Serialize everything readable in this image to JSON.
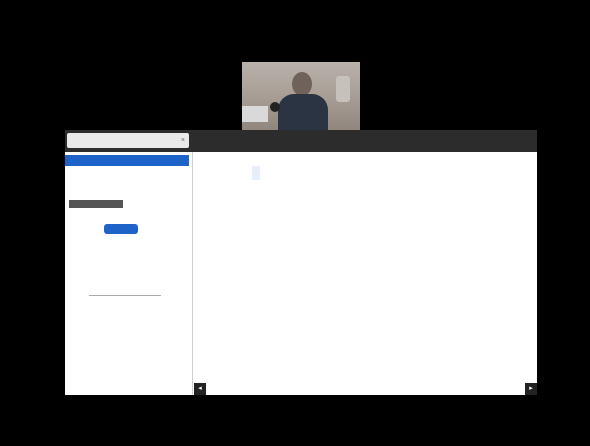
{
  "tab": {
    "title": "",
    "close_glyph": "×"
  },
  "menu": {
    "left": "",
    "right": ""
  },
  "panel": {
    "selected_row": "",
    "text_block": "",
    "note": "",
    "button_label": "",
    "note2": "",
    "small_label": "",
    "math_small": ""
  },
  "canvas": {
    "eq1_left": "",
    "eq1_highlight": "",
    "eq_number": "",
    "eq2": "",
    "mark": "",
    "nav_prev": "◂",
    "nav_next": "▸"
  },
  "icons": {
    "close": "close-icon",
    "prev": "prev-page-icon",
    "next": "next-page-icon"
  },
  "colors": {
    "accent": "#1e63c8",
    "toolbar": "#2c2c2c",
    "background": "#000000"
  }
}
